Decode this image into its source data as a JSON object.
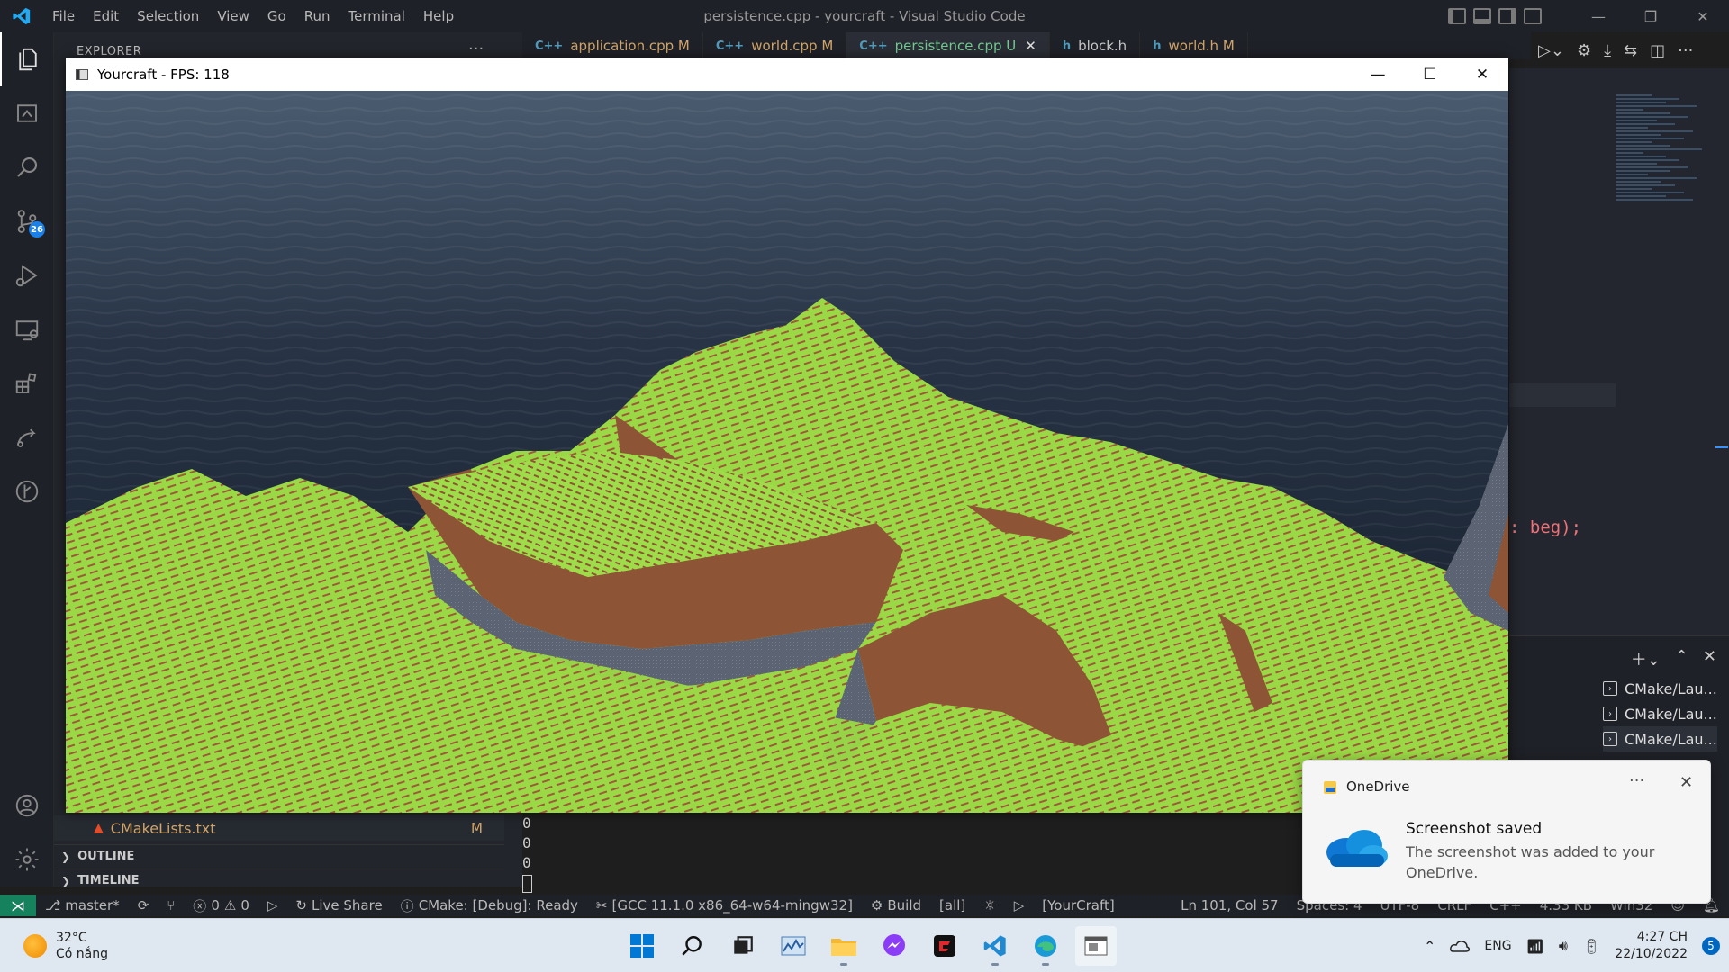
{
  "vscode": {
    "title": "persistence.cpp - yourcraft - Visual Studio Code",
    "menu": [
      "File",
      "Edit",
      "Selection",
      "View",
      "Go",
      "Run",
      "Terminal",
      "Help"
    ],
    "explorer_label": "EXPLORER",
    "tabs": [
      {
        "icon": "C++",
        "label": "application.cpp",
        "status": "M"
      },
      {
        "icon": "C++",
        "label": "world.cpp",
        "status": "M"
      },
      {
        "icon": "C++",
        "label": "persistence.cpp",
        "status": "U",
        "active": true
      },
      {
        "icon": "h",
        "label": "block.h",
        "status": ""
      },
      {
        "icon": "h",
        "label": "world.h",
        "status": "M"
      }
    ],
    "scm_badge": "26",
    "code_snippet": ": beg);",
    "sidebar": {
      "file_name": "CMakeLists.txt",
      "file_status": "M",
      "outline_label": "OUTLINE",
      "timeline_label": "TIMELINE"
    },
    "terminal_output": [
      "0",
      "0",
      "0"
    ],
    "terminals": [
      "CMake/Lau...",
      "CMake/Lau...",
      "CMake/Lau..."
    ]
  },
  "statusbar": {
    "branch": "master*",
    "errors": "0",
    "warnings": "0",
    "live_share": "Live Share",
    "cmake_status": "CMake: [Debug]: Ready",
    "kit": "[GCC 11.1.0 x86_64-w64-mingw32]",
    "build": "Build",
    "build_target": "[all]",
    "launch_target": "[YourCraft]",
    "position": "Ln 101, Col 57",
    "spaces": "Spaces: 4",
    "encoding": "UTF-8",
    "eol": "CRLF",
    "language": "C++",
    "size": "4.33 KB",
    "platform": "Win32"
  },
  "game": {
    "window_title": "Yourcraft - FPS: 118"
  },
  "toast": {
    "app": "OneDrive",
    "title": "Screenshot saved",
    "body": "The screenshot was added to your OneDrive."
  },
  "taskbar": {
    "temperature": "32°C",
    "weather": "Có nắng",
    "language": "ENG",
    "time": "4:27 CH",
    "date": "22/10/2022",
    "notifications": "5"
  }
}
